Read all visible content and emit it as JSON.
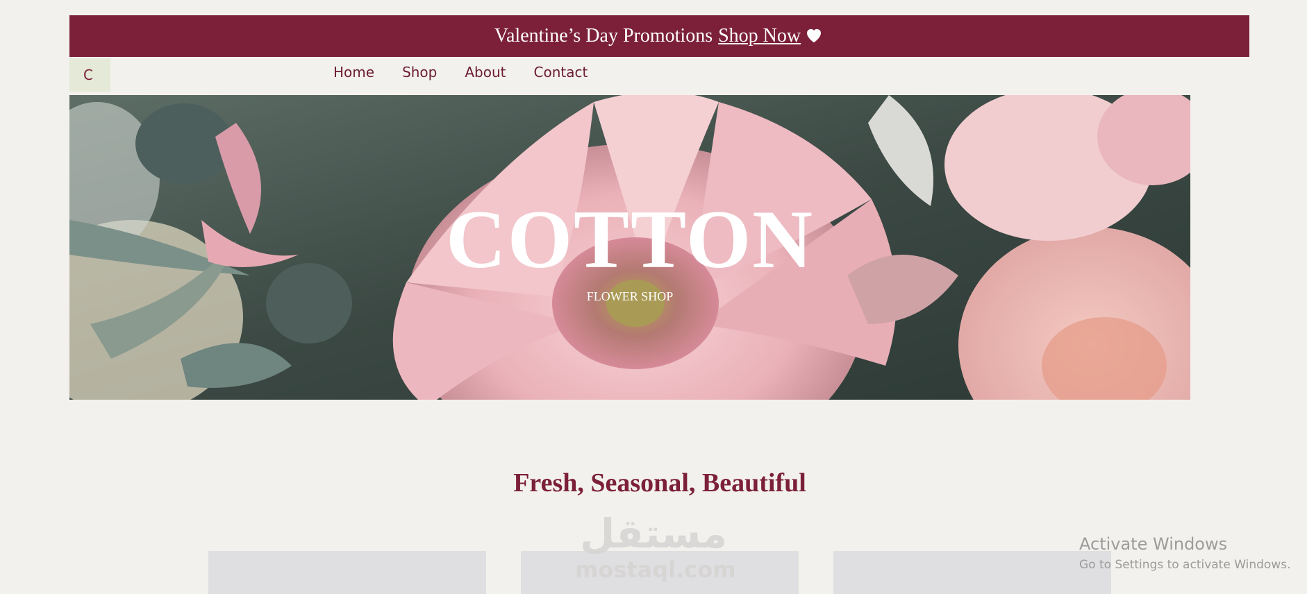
{
  "promo": {
    "text": "Valentine’s Day Promotions",
    "link": "Shop Now",
    "icon": "heart-icon",
    "background": "#7c203a"
  },
  "nav": {
    "logo": "C",
    "items": [
      "Home",
      "Shop",
      "About",
      "Contact"
    ]
  },
  "hero": {
    "title": "COTTON",
    "subtitle": "FLOWER SHOP"
  },
  "section": {
    "title": "Fresh, Seasonal, Beautiful",
    "cards": [
      "",
      "",
      ""
    ]
  },
  "watermark": {
    "arabic": "مستقل",
    "site": "mostaql.com"
  },
  "windows": {
    "title": "Activate Windows",
    "message": "Go to Settings to activate Windows."
  },
  "colors": {
    "accent": "#7c203a",
    "page_background": "#f3f1ed"
  }
}
